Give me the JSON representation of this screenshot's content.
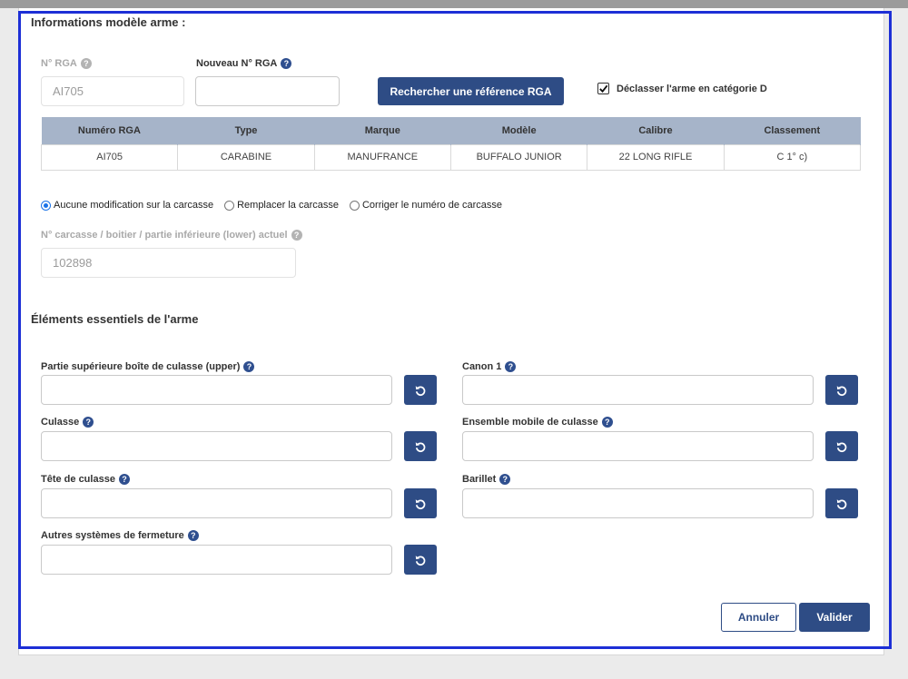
{
  "section_model": {
    "title": "Informations modèle arme :"
  },
  "rga": {
    "current_label": "N° RGA",
    "current_value": "AI705",
    "new_label": "Nouveau N° RGA",
    "new_value": "",
    "search_button": "Rechercher une référence RGA",
    "declass_label": "Déclasser l'arme en catégorie D",
    "declass_checked": true
  },
  "table": {
    "headers": [
      "Numéro RGA",
      "Type",
      "Marque",
      "Modèle",
      "Calibre",
      "Classement"
    ],
    "rows": [
      [
        "AI705",
        "CARABINE",
        "MANUFRANCE",
        "BUFFALO JUNIOR",
        "22 LONG RIFLE",
        "C 1° c)"
      ]
    ]
  },
  "carcasse_options": {
    "options": [
      "Aucune modification sur la carcasse",
      "Remplacer la carcasse",
      "Corriger le numéro de carcasse"
    ],
    "selected": "Aucune modification sur la carcasse"
  },
  "carcasse_number": {
    "label": "N° carcasse / boitier / partie inférieure (lower) actuel",
    "value": "102898"
  },
  "section_elements": {
    "title": "Éléments essentiels de l'arme"
  },
  "elements": {
    "upper": {
      "label": "Partie supérieure boîte de culasse (upper)",
      "value": ""
    },
    "canon": {
      "label": "Canon 1",
      "value": ""
    },
    "culasse": {
      "label": "Culasse",
      "value": ""
    },
    "ensemble": {
      "label": "Ensemble mobile de culasse",
      "value": ""
    },
    "tete": {
      "label": "Tête de culasse",
      "value": ""
    },
    "barillet": {
      "label": "Barillet",
      "value": ""
    },
    "autres": {
      "label": "Autres systèmes de fermeture",
      "value": ""
    }
  },
  "footer": {
    "cancel": "Annuler",
    "submit": "Valider"
  },
  "icons": {
    "help": "question-circle-icon",
    "reset": "undo-icon",
    "check": "check-icon"
  },
  "colors": {
    "primary": "#2e4c85",
    "table_header": "#a6b4c9",
    "radio": "#1a73e8",
    "focus_frame": "#1d2fd6"
  }
}
